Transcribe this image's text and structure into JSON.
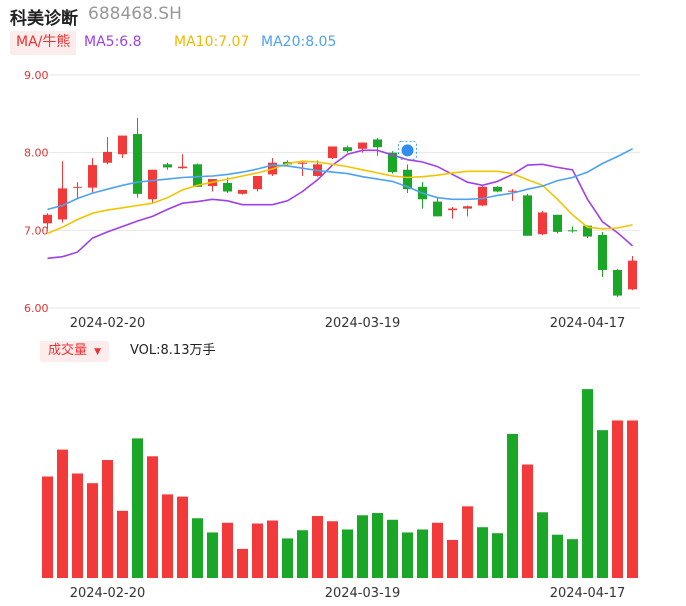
{
  "header": {
    "name": "科美诊断",
    "code": "688468.SH"
  },
  "ma_legend": {
    "tag": "MA/牛熊",
    "ma5": "MA5:6.8",
    "ma10": "MA10:7.07",
    "ma20": "MA20:8.05"
  },
  "volume_legend": {
    "tag": "成交量",
    "tag_arrow": "▼",
    "value": "VOL:8.13万手"
  },
  "colors": {
    "up": "#f23a3a",
    "down": "#1aa626",
    "ma5": "#a040e8",
    "ma10": "#f2c500",
    "ma20": "#4ea2f0",
    "grid": "#e6e6e6",
    "price_axis": "#e33333"
  },
  "chart_data": [
    {
      "type": "candlestick",
      "yticks": [
        "9.00",
        "8.00",
        "7.00",
        "6.00"
      ],
      "ylim": [
        6.0,
        9.0
      ],
      "xticks": [
        {
          "label": "2024-02-20",
          "index": 4
        },
        {
          "label": "2024-03-19",
          "index": 21
        },
        {
          "label": "2024-04-17",
          "index": 36
        }
      ],
      "candles": [
        {
          "o": 7.09,
          "h": 7.22,
          "l": 7.02,
          "c": 7.2
        },
        {
          "o": 7.14,
          "h": 7.89,
          "l": 7.1,
          "c": 7.54
        },
        {
          "o": 7.56,
          "h": 7.62,
          "l": 7.4,
          "c": 7.56
        },
        {
          "o": 7.55,
          "h": 7.93,
          "l": 7.49,
          "c": 7.84
        },
        {
          "o": 7.87,
          "h": 8.2,
          "l": 7.85,
          "c": 8.01
        },
        {
          "o": 7.98,
          "h": 8.22,
          "l": 7.93,
          "c": 8.22
        },
        {
          "o": 8.24,
          "h": 8.45,
          "l": 7.42,
          "c": 7.47
        },
        {
          "o": 7.4,
          "h": 7.78,
          "l": 7.35,
          "c": 7.78
        },
        {
          "o": 7.85,
          "h": 7.87,
          "l": 7.78,
          "c": 7.81
        },
        {
          "o": 7.8,
          "h": 7.98,
          "l": 7.79,
          "c": 7.82
        },
        {
          "o": 7.85,
          "h": 7.86,
          "l": 7.56,
          "c": 7.56
        },
        {
          "o": 7.57,
          "h": 7.64,
          "l": 7.5,
          "c": 7.66
        },
        {
          "o": 7.61,
          "h": 7.68,
          "l": 7.48,
          "c": 7.5
        },
        {
          "o": 7.47,
          "h": 7.52,
          "l": 7.46,
          "c": 7.52
        },
        {
          "o": 7.53,
          "h": 7.7,
          "l": 7.5,
          "c": 7.7
        },
        {
          "o": 7.72,
          "h": 7.93,
          "l": 7.7,
          "c": 7.87
        },
        {
          "o": 7.88,
          "h": 7.9,
          "l": 7.83,
          "c": 7.85
        },
        {
          "o": 7.87,
          "h": 7.9,
          "l": 7.7,
          "c": 7.87
        },
        {
          "o": 7.7,
          "h": 7.9,
          "l": 7.69,
          "c": 7.85
        },
        {
          "o": 7.93,
          "h": 8.08,
          "l": 7.92,
          "c": 8.08
        },
        {
          "o": 8.07,
          "h": 8.09,
          "l": 8.0,
          "c": 8.02
        },
        {
          "o": 8.05,
          "h": 8.13,
          "l": 8.0,
          "c": 8.13
        },
        {
          "o": 8.17,
          "h": 8.19,
          "l": 7.96,
          "c": 8.07
        },
        {
          "o": 8.0,
          "h": 8.02,
          "l": 7.73,
          "c": 7.75
        },
        {
          "o": 7.78,
          "h": 7.85,
          "l": 7.48,
          "c": 7.53
        },
        {
          "o": 7.56,
          "h": 7.62,
          "l": 7.28,
          "c": 7.4
        },
        {
          "o": 7.37,
          "h": 7.43,
          "l": 7.18,
          "c": 7.18
        },
        {
          "o": 7.26,
          "h": 7.3,
          "l": 7.15,
          "c": 7.28
        },
        {
          "o": 7.28,
          "h": 7.32,
          "l": 7.18,
          "c": 7.31
        },
        {
          "o": 7.32,
          "h": 7.57,
          "l": 7.31,
          "c": 7.56
        },
        {
          "o": 7.56,
          "h": 7.57,
          "l": 7.49,
          "c": 7.5
        },
        {
          "o": 7.5,
          "h": 7.53,
          "l": 7.38,
          "c": 7.51
        },
        {
          "o": 7.45,
          "h": 7.47,
          "l": 6.93,
          "c": 6.93
        },
        {
          "o": 6.95,
          "h": 7.25,
          "l": 6.94,
          "c": 7.23
        },
        {
          "o": 7.2,
          "h": 7.2,
          "l": 6.96,
          "c": 6.98
        },
        {
          "o": 7.0,
          "h": 7.05,
          "l": 6.97,
          "c": 6.99
        },
        {
          "o": 7.06,
          "h": 7.06,
          "l": 6.9,
          "c": 6.92
        },
        {
          "o": 6.94,
          "h": 6.98,
          "l": 6.4,
          "c": 6.49
        },
        {
          "o": 6.49,
          "h": 6.5,
          "l": 6.14,
          "c": 6.16
        },
        {
          "o": 6.24,
          "h": 6.67,
          "l": 6.23,
          "c": 6.61
        }
      ],
      "ma5": [
        6.64,
        6.66,
        6.72,
        6.9,
        6.98,
        7.05,
        7.12,
        7.18,
        7.27,
        7.35,
        7.37,
        7.4,
        7.38,
        7.33,
        7.33,
        7.33,
        7.38,
        7.5,
        7.65,
        7.84,
        7.98,
        8.03,
        8.03,
        7.97,
        7.91,
        7.88,
        7.82,
        7.72,
        7.62,
        7.58,
        7.63,
        7.72,
        7.84,
        7.85,
        7.81,
        7.78,
        7.4,
        7.11,
        6.97,
        6.8
      ],
      "ma10": [
        6.96,
        7.04,
        7.14,
        7.22,
        7.26,
        7.29,
        7.32,
        7.35,
        7.42,
        7.52,
        7.58,
        7.62,
        7.66,
        7.7,
        7.74,
        7.79,
        7.86,
        7.89,
        7.88,
        7.85,
        7.82,
        7.78,
        7.74,
        7.7,
        7.68,
        7.69,
        7.71,
        7.74,
        7.76,
        7.76,
        7.76,
        7.73,
        7.65,
        7.58,
        7.4,
        7.2,
        7.04,
        7.02,
        7.03,
        7.07
      ],
      "ma20": [
        7.27,
        7.32,
        7.41,
        7.48,
        7.53,
        7.58,
        7.62,
        7.64,
        7.66,
        7.68,
        7.69,
        7.7,
        7.72,
        7.75,
        7.79,
        7.84,
        7.83,
        7.8,
        7.77,
        7.75,
        7.73,
        7.69,
        7.66,
        7.63,
        7.56,
        7.48,
        7.42,
        7.4,
        7.4,
        7.41,
        7.45,
        7.48,
        7.53,
        7.57,
        7.64,
        7.68,
        7.75,
        7.86,
        7.95,
        8.05
      ]
    },
    {
      "type": "bar",
      "title": "成交量",
      "values": [
        13.6,
        17.2,
        14.0,
        12.7,
        15.8,
        9.0,
        18.7,
        16.3,
        11.2,
        10.9,
        8.0,
        6.1,
        7.4,
        3.9,
        7.3,
        7.7,
        5.3,
        6.4,
        8.3,
        7.6,
        6.5,
        8.4,
        8.7,
        7.8,
        6.1,
        6.5,
        7.4,
        5.1,
        9.6,
        6.8,
        6.0,
        19.3,
        15.2,
        8.8,
        5.8,
        5.2,
        25.3,
        19.8,
        21.1,
        21.1
      ],
      "directions": [
        "up",
        "up",
        "up",
        "up",
        "up",
        "up",
        "down",
        "up",
        "up",
        "up",
        "down",
        "down",
        "up",
        "up",
        "up",
        "up",
        "down",
        "down",
        "up",
        "up",
        "down",
        "down",
        "down",
        "down",
        "down",
        "down",
        "up",
        "up",
        "up",
        "down",
        "down",
        "down",
        "up",
        "down",
        "down",
        "down",
        "down",
        "down",
        "up",
        "up"
      ]
    }
  ]
}
